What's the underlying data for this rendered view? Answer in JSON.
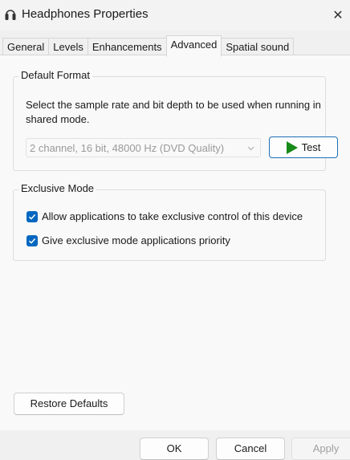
{
  "window": {
    "title": "Headphones Properties",
    "icon": "headphones-icon",
    "close_glyph": "✕"
  },
  "tabs": [
    {
      "label": "General",
      "active": false
    },
    {
      "label": "Levels",
      "active": false
    },
    {
      "label": "Enhancements",
      "active": false
    },
    {
      "label": "Advanced",
      "active": true
    },
    {
      "label": "Spatial sound",
      "active": false
    }
  ],
  "default_format": {
    "legend": "Default Format",
    "description": "Select the sample rate and bit depth to be used when running in shared mode.",
    "selected_format": "2 channel, 16 bit, 48000 Hz (DVD Quality)",
    "test_label": "Test"
  },
  "exclusive_mode": {
    "legend": "Exclusive Mode",
    "options": [
      {
        "label": "Allow applications to take exclusive control of this device",
        "checked": true
      },
      {
        "label": "Give exclusive mode applications priority",
        "checked": true
      }
    ]
  },
  "restore_defaults_label": "Restore Defaults",
  "footer": {
    "ok_label": "OK",
    "cancel_label": "Cancel",
    "apply_label": "Apply"
  },
  "colors": {
    "checkbox_accent": "#0067c0",
    "play_icon": "#188a18",
    "test_border": "#1f6fb6"
  }
}
